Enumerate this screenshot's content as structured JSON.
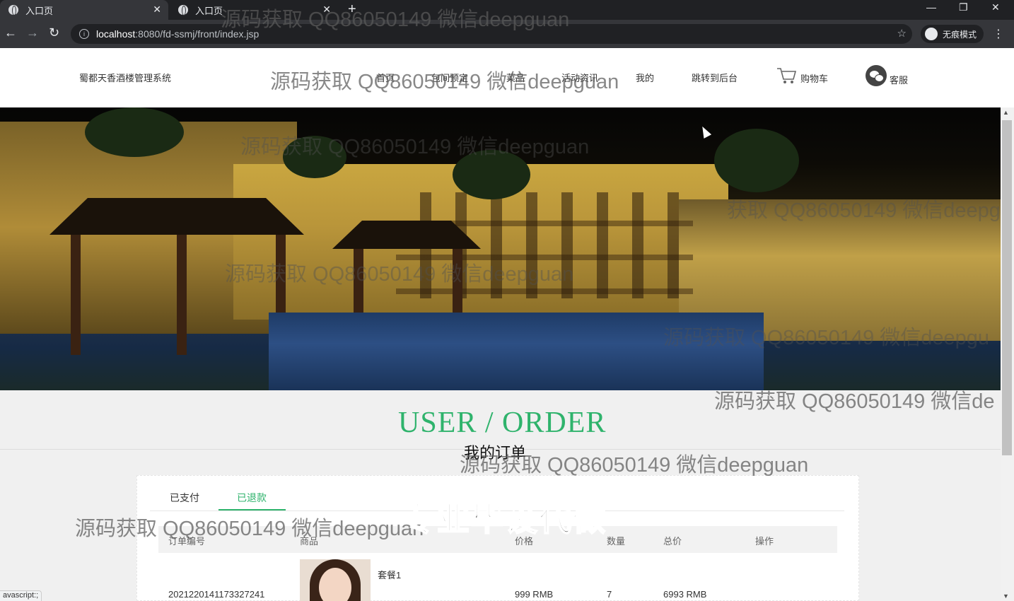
{
  "browser": {
    "tabs": [
      {
        "title": "入口页",
        "close": "✕"
      },
      {
        "title": "入口页",
        "close": "✕"
      }
    ],
    "new_tab": "+",
    "window": {
      "minimize": "—",
      "restore": "❐",
      "close": "✕"
    },
    "nav": {
      "back": "←",
      "forward": "→",
      "reload": "↻"
    },
    "url": {
      "host": "localhost",
      "path": ":8080/fd-ssmj/front/index.jsp"
    },
    "incognito_label": "无痕模式",
    "status_text": "avascript:;"
  },
  "site": {
    "brand": "蜀都天香酒楼管理系统",
    "nav": [
      "首页",
      "包间预定",
      "菜品",
      "活动资讯",
      "我的",
      "跳转到后台"
    ],
    "cart_label": "购物车",
    "service_label": "客服"
  },
  "page": {
    "title_en": "USER / ORDER",
    "title_cn": "我的订单"
  },
  "orders": {
    "tabs": [
      "已支付",
      "已退款"
    ],
    "active_tab": 1,
    "columns": [
      "订单编号",
      "商品",
      "价格",
      "数量",
      "总价",
      "操作"
    ],
    "rows": [
      {
        "order_no": "2021220141173327241",
        "product": "套餐1",
        "price": "999 RMB",
        "qty": "7",
        "total": "6993 RMB",
        "action": ""
      }
    ]
  },
  "watermarks": {
    "source_text": "源码获取 QQ86050149 微信deepguan",
    "partial_1": "获取 QQ86050149 微信deepg",
    "partial_2": "源码获取 QQ86050149 微信deepgu",
    "partial_3": "源码获取 QQ86050149 微信de",
    "banner": "专业毕设代做"
  }
}
